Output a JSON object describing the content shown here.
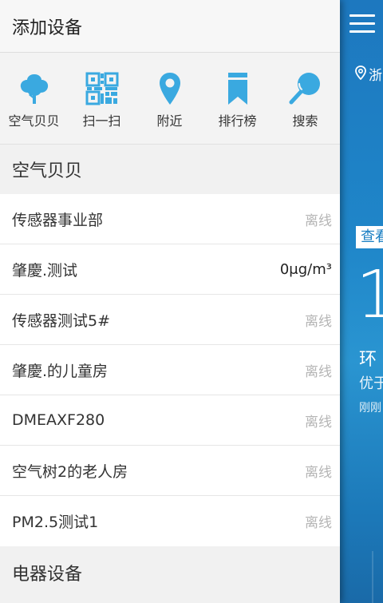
{
  "drawer": {
    "title": "添加设备",
    "actions": [
      {
        "label": "空气贝贝",
        "icon": "tree-icon"
      },
      {
        "label": "扫一扫",
        "icon": "qr-code-icon"
      },
      {
        "label": "附近",
        "icon": "location-pin-icon"
      },
      {
        "label": "排行榜",
        "icon": "bookmark-icon"
      },
      {
        "label": "搜索",
        "icon": "search-icon"
      }
    ],
    "section1": "空气贝贝",
    "devices": [
      {
        "name": "传感器事业部",
        "status": "离线"
      },
      {
        "name": "肇慶.测试",
        "status": "0μg/m³"
      },
      {
        "name": "传感器测试5#",
        "status": "离线"
      },
      {
        "name": "肇慶.的儿童房",
        "status": "离线"
      },
      {
        "name": "DMEAXF280",
        "status": "离线"
      },
      {
        "name": "空气树2的老人房",
        "status": "离线"
      },
      {
        "name": "PM2.5测试1",
        "status": "离线"
      }
    ],
    "section2": "电器设备"
  },
  "background": {
    "location": "浙",
    "check_badge": "查看",
    "big_value": "1",
    "env_label": "环",
    "grade_label": "优于",
    "time_label": "刚刚"
  },
  "colors": {
    "accent": "#3aa9e0",
    "panel_bg": "#1f86c9",
    "offline": "#b5b5b5"
  }
}
